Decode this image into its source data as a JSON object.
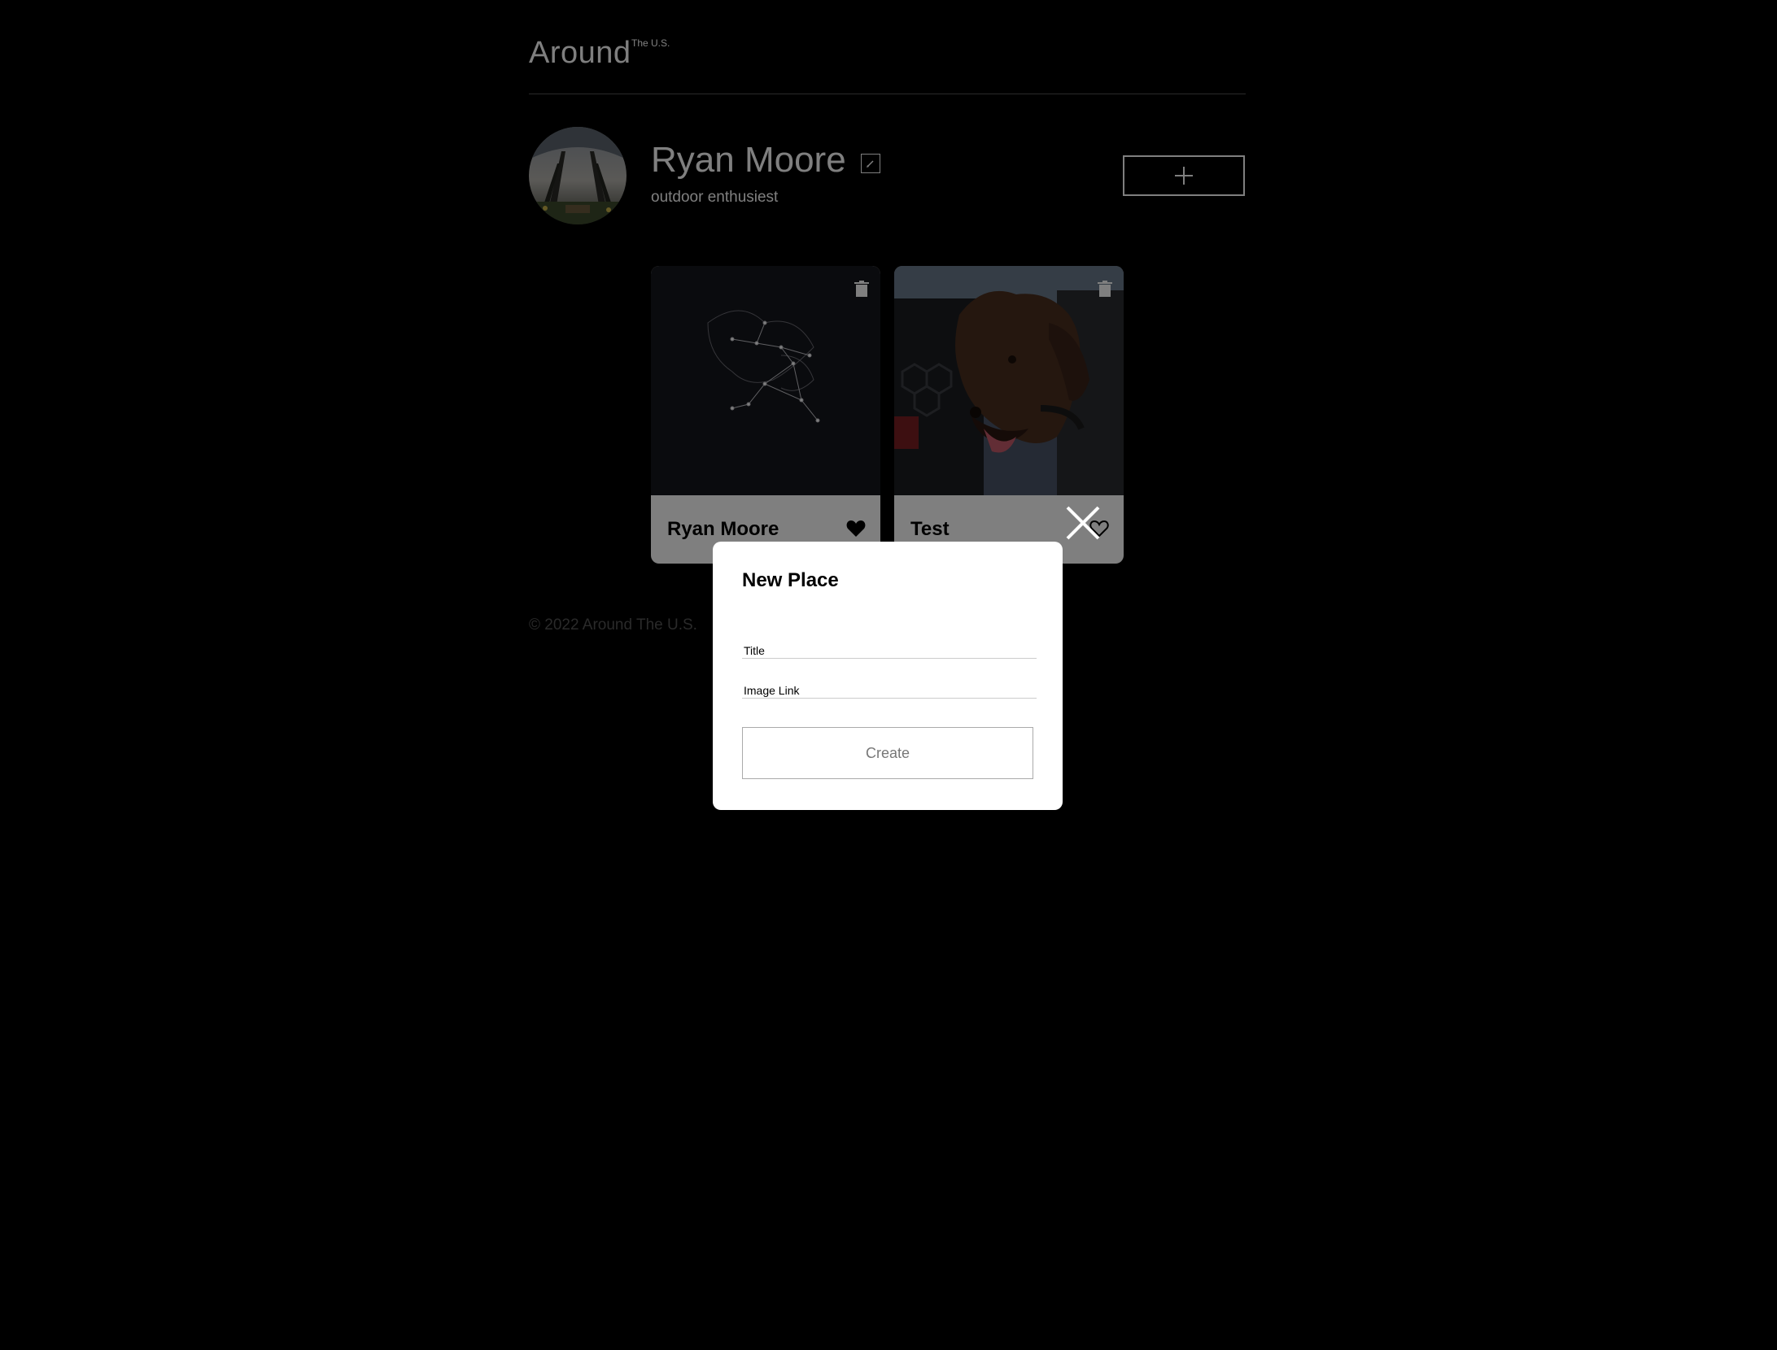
{
  "header": {
    "logo_text": "Around",
    "logo_superscript": "The U.S."
  },
  "profile": {
    "name": "Ryan Moore",
    "about": "outdoor enthusiest",
    "avatar_alt": "Profile photo"
  },
  "cards": [
    {
      "title": "Ryan Moore",
      "liked": true,
      "image_alt": "Constellation"
    },
    {
      "title": "Test",
      "liked": false,
      "image_alt": "Dog"
    }
  ],
  "footer": {
    "text": "© 2022 Around The U.S."
  },
  "modal": {
    "title": "New Place",
    "title_placeholder": "Title",
    "link_placeholder": "Image Link",
    "submit_label": "Create"
  },
  "icons": {
    "edit": "pencil-icon",
    "add": "plus-icon",
    "delete": "trash-icon",
    "like": "heart-icon",
    "close": "close-icon"
  }
}
